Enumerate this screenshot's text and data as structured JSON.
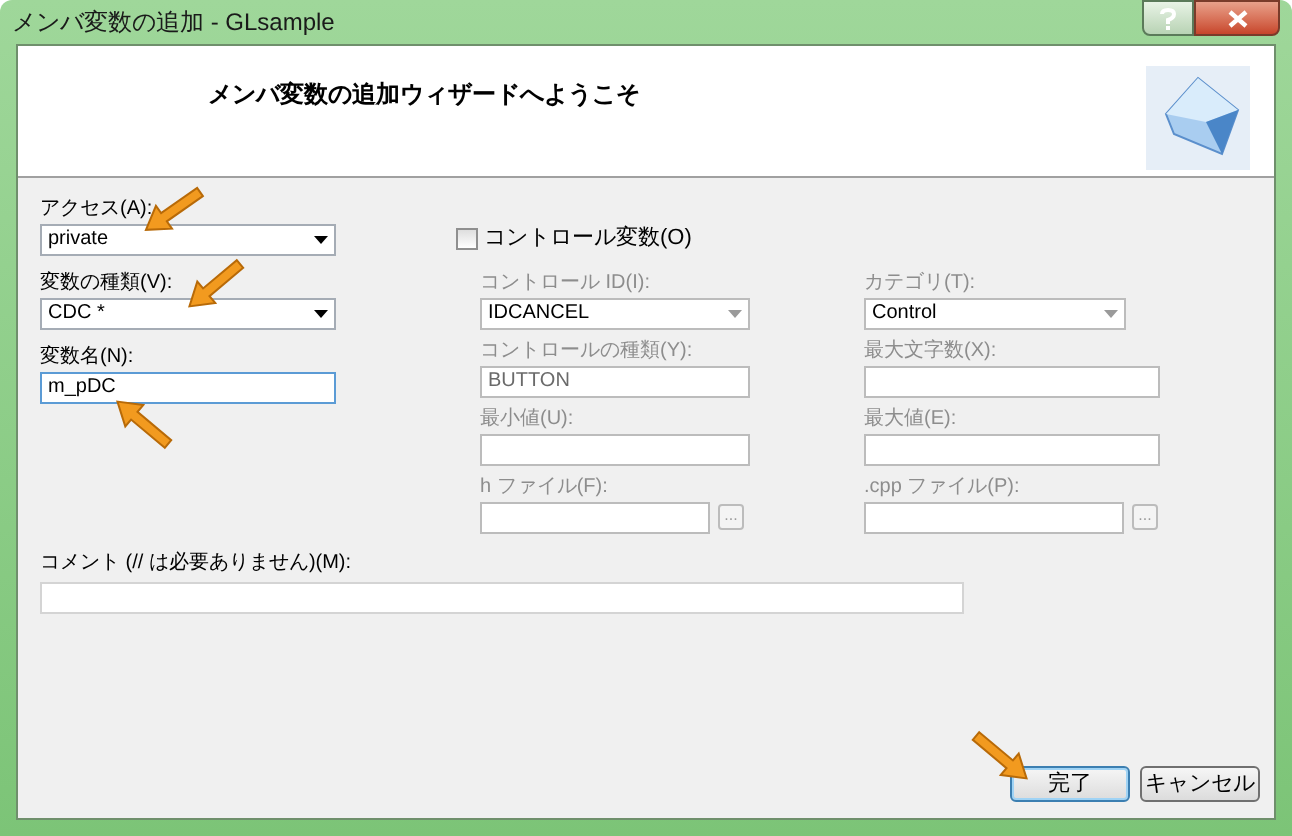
{
  "window": {
    "title": "メンバ変数の追加 - GLsample"
  },
  "header": {
    "title": "メンバ変数の追加ウィザードへようこそ"
  },
  "left_fields": [
    {
      "kind": "combo",
      "label": "アクセス(A):",
      "value": "private"
    },
    {
      "kind": "combo",
      "label": "変数の種類(V):",
      "value": "CDC *"
    },
    {
      "kind": "text",
      "label": "変数名(N):",
      "value": "m_pDC",
      "focused": true
    }
  ],
  "control_variable": {
    "label": "コントロール変数(O)",
    "checked": false
  },
  "control_fields": [
    {
      "kind": "combo",
      "label": "コントロール ID(I):",
      "value": "IDCANCEL",
      "disabled": true
    },
    {
      "kind": "combo",
      "label": "カテゴリ(T):",
      "value": "Control",
      "disabled": true
    },
    {
      "kind": "text",
      "label": "コントロールの種類(Y):",
      "value": "BUTTON",
      "disabled": true
    },
    {
      "kind": "text",
      "label": "最大文字数(X):",
      "disabled": true
    },
    {
      "kind": "text",
      "label": "最小値(U):",
      "disabled": true
    },
    {
      "kind": "text",
      "label": "最大値(E):",
      "disabled": true
    },
    {
      "kind": "file",
      "label": "h ファイル(F):",
      "button": "...",
      "disabled": true
    },
    {
      "kind": "file",
      "label": ".cpp ファイル(P):",
      "button": "...",
      "disabled": true
    }
  ],
  "comment": {
    "label": "コメント (// は必要ありません)(M):"
  },
  "buttons": [
    {
      "label": "完了",
      "default": true
    },
    {
      "label": "キャンセル",
      "default": false
    }
  ]
}
